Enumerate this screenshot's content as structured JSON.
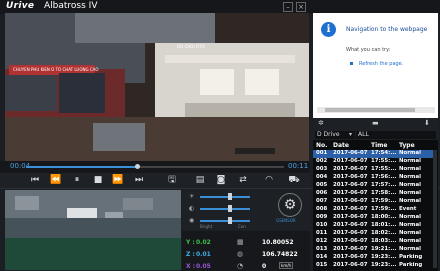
{
  "app": {
    "logo": "Urive",
    "title": "Albatross IV"
  },
  "player": {
    "time_current": "00:04",
    "time_total": "00:11",
    "progress_fraction": 0.43,
    "video_sign": "CHUYEN PHU KIEN O TO CHAT LUONG CAO",
    "video_sign_right": "DO CHOI OTO"
  },
  "controls": [
    "prev-start",
    "rewind",
    "pause",
    "stop",
    "forward",
    "next-end",
    "save",
    "film",
    "camera",
    "swap",
    "speed",
    "car"
  ],
  "settings": {
    "slider1_fraction": 0.6,
    "slider2_fraction": 0.6,
    "slider3_fraction": 0.6,
    "slider_left_label": "Bright",
    "slider_right_label": "Con",
    "gsensor_label": "GSENSOR"
  },
  "gsensor": {
    "y_label": "Y :",
    "y_value": "0.02",
    "z_label": "Z :",
    "z_value": "0.01",
    "x_label": "X :",
    "x_value": "0.05",
    "lat": "10.80052",
    "lon": "106.74822",
    "speed": "0",
    "speed_unit": "km/h"
  },
  "browser": {
    "heading": "Navigation to the webpage",
    "try_text": "What you can try:",
    "refresh": "Refresh the page."
  },
  "files": {
    "drive": "D Drive",
    "filter": "ALL",
    "headers": [
      "No.",
      "Date",
      "Time",
      "Type"
    ],
    "rows": [
      [
        "001",
        "2017-06-07",
        "17:54:...",
        "Normal"
      ],
      [
        "002",
        "2017-06-07",
        "17:55:...",
        "Normal"
      ],
      [
        "003",
        "2017-06-07",
        "17:55:...",
        "Normal"
      ],
      [
        "004",
        "2017-06-07",
        "17:56:...",
        "Normal"
      ],
      [
        "005",
        "2017-06-07",
        "17:57:...",
        "Normal"
      ],
      [
        "006",
        "2017-06-07",
        "17:58:...",
        "Normal"
      ],
      [
        "007",
        "2017-06-07",
        "17:59:...",
        "Normal"
      ],
      [
        "008",
        "2017-06-07",
        "17:59:...",
        "Event"
      ],
      [
        "009",
        "2017-06-07",
        "18:00:...",
        "Normal"
      ],
      [
        "010",
        "2017-06-07",
        "18:01:...",
        "Normal"
      ],
      [
        "011",
        "2017-06-07",
        "18:02:...",
        "Normal"
      ],
      [
        "012",
        "2017-06-07",
        "18:03:...",
        "Normal"
      ],
      [
        "013",
        "2017-06-07",
        "19:21:...",
        "Normal"
      ],
      [
        "014",
        "2017-06-07",
        "19:23:...",
        "Parking"
      ],
      [
        "015",
        "2017-06-07",
        "19:23:...",
        "Parking"
      ]
    ]
  },
  "colors": {
    "accent": "#3b8fd6",
    "selected_row": "#2b5fa8",
    "y": "#38c24a",
    "z": "#3fb1e8",
    "x": "#9a56d8"
  }
}
